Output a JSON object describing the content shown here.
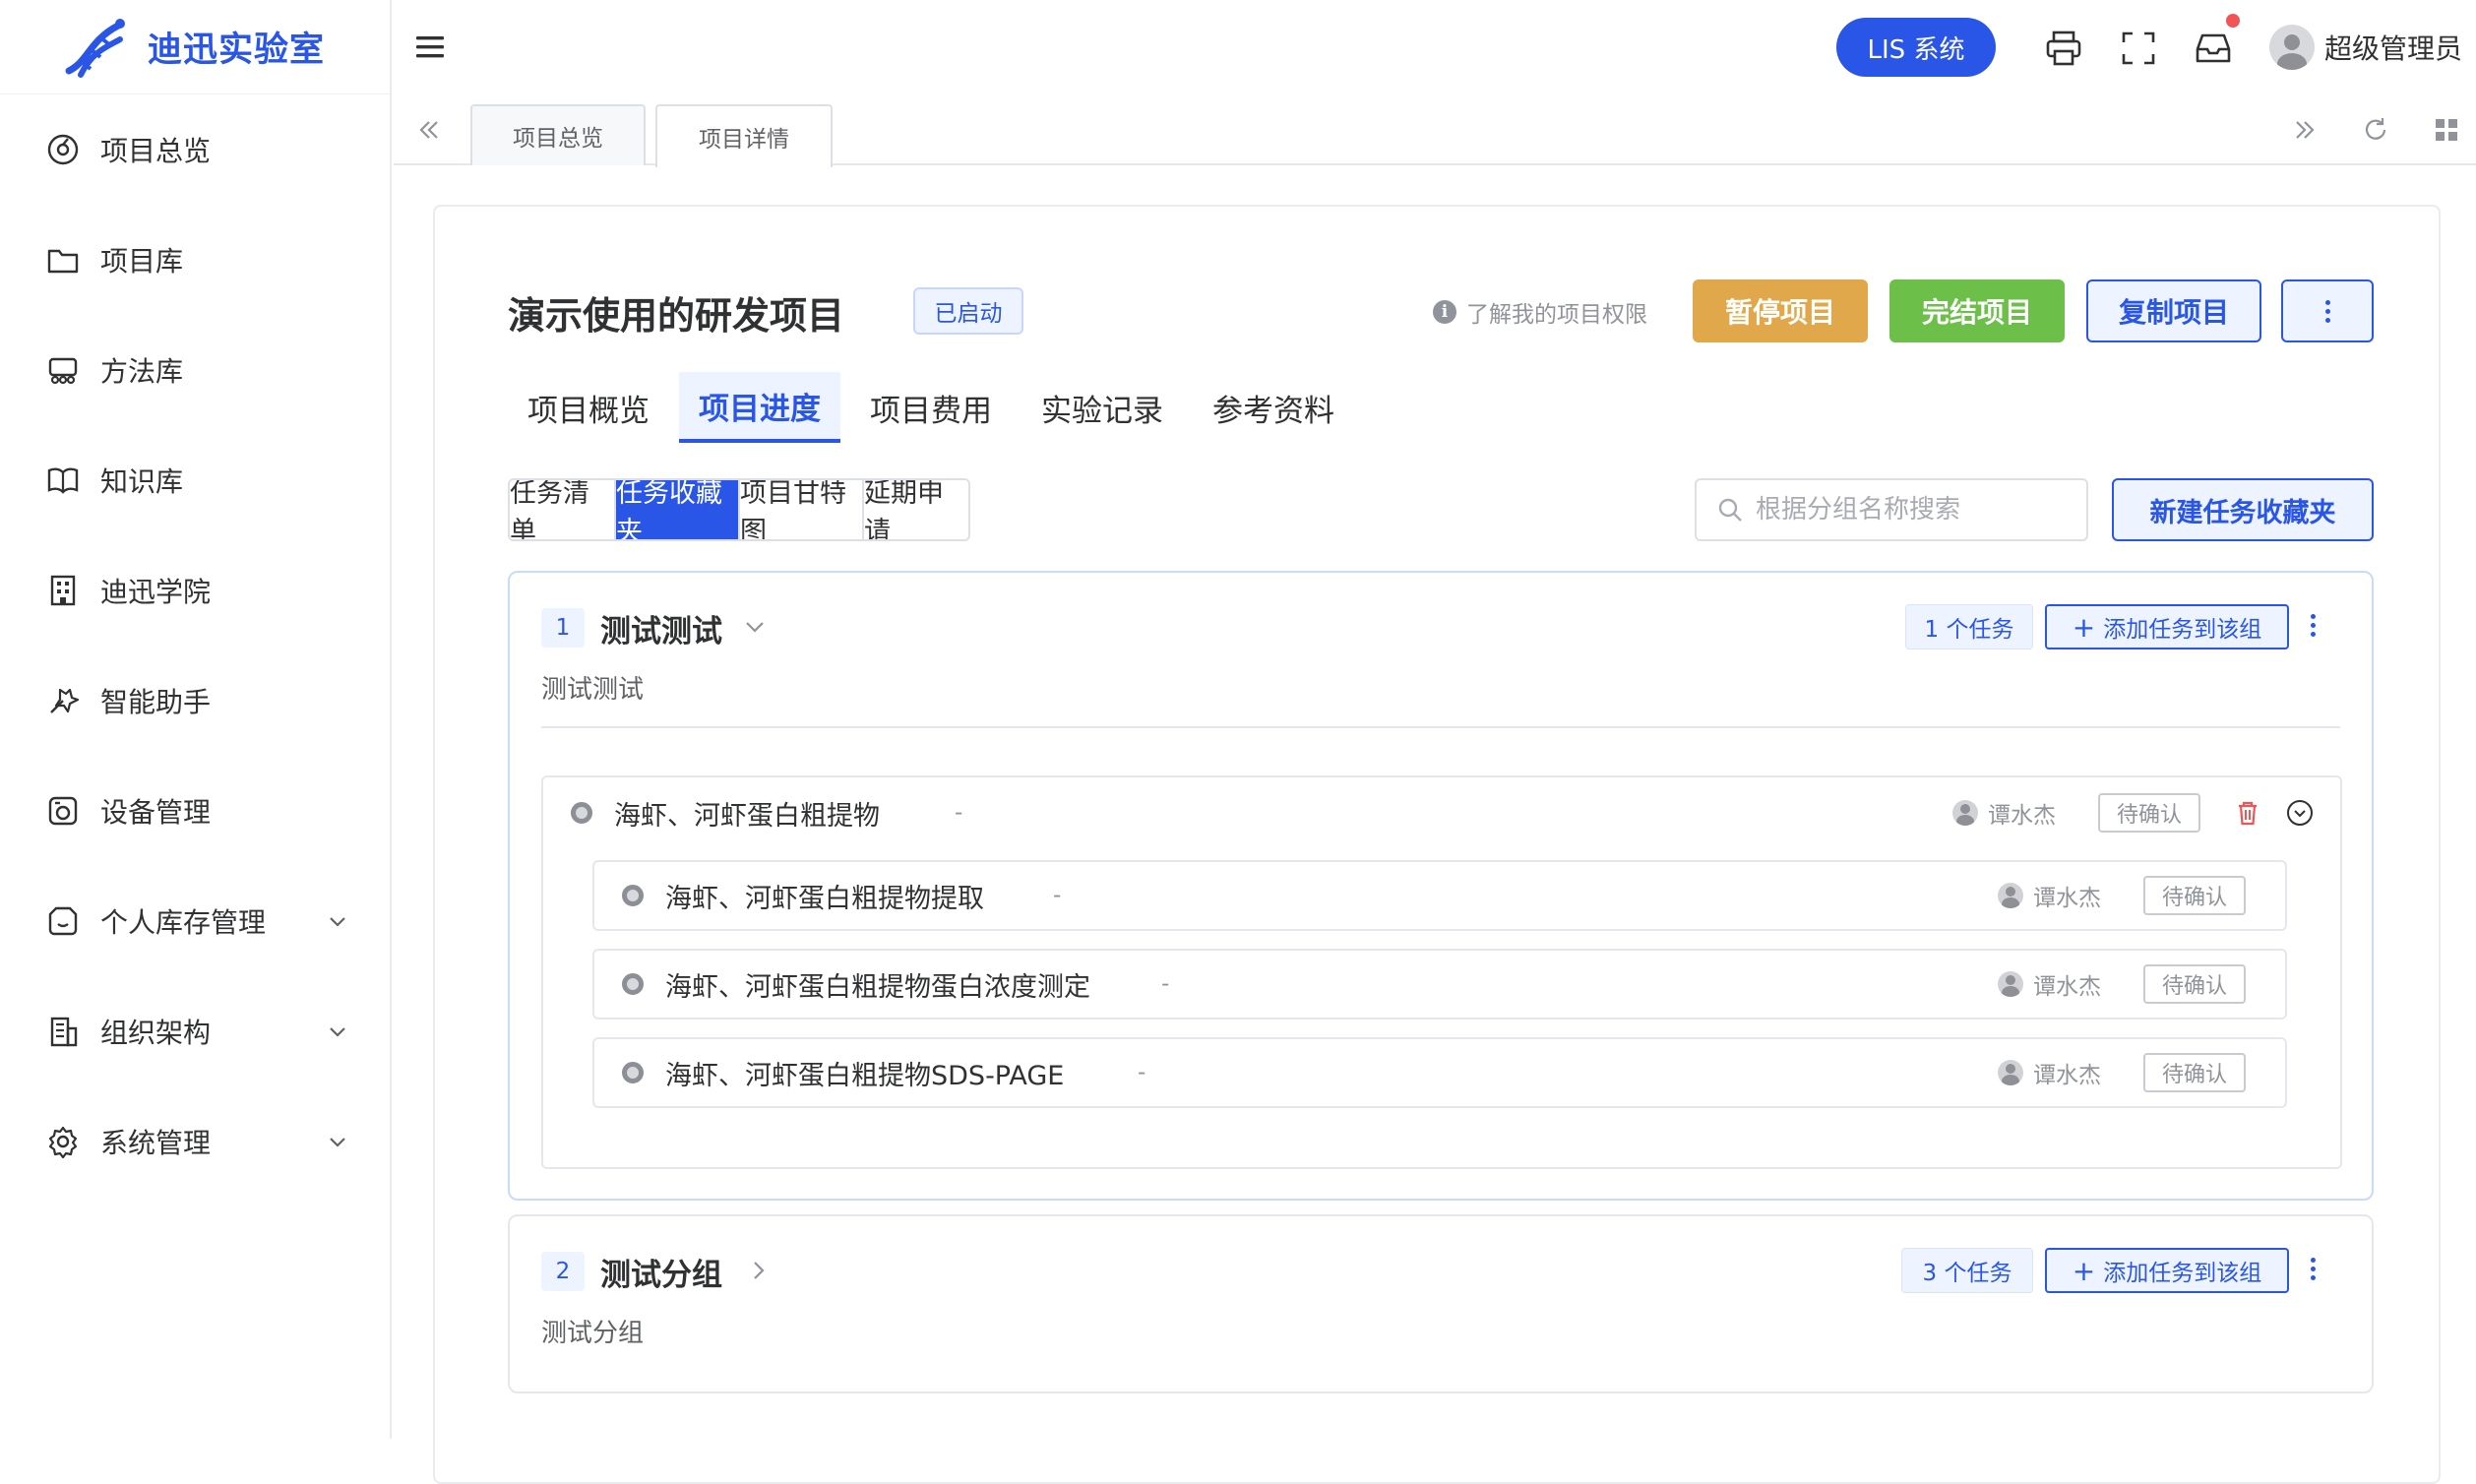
{
  "brand": {
    "name": "迪迅实验室",
    "color": "#2a56e8"
  },
  "sidebar": {
    "items": [
      {
        "label": "项目总览",
        "icon": "dashboard-icon"
      },
      {
        "label": "项目库",
        "icon": "folder-icon"
      },
      {
        "label": "方法库",
        "icon": "method-icon"
      },
      {
        "label": "知识库",
        "icon": "book-icon"
      },
      {
        "label": "迪迅学院",
        "icon": "building-icon"
      },
      {
        "label": "智能助手",
        "icon": "assistant-icon"
      },
      {
        "label": "设备管理",
        "icon": "device-icon"
      },
      {
        "label": "个人库存管理",
        "icon": "inventory-icon",
        "expandable": true
      },
      {
        "label": "组织架构",
        "icon": "org-icon",
        "expandable": true
      },
      {
        "label": "系统管理",
        "icon": "settings-icon",
        "expandable": true
      }
    ]
  },
  "topbar": {
    "lis_label": "LIS 系统",
    "user_name": "超级管理员",
    "notification_dot_color": "#f05454"
  },
  "page_tabs": [
    {
      "label": "项目总览",
      "active": false
    },
    {
      "label": "项目详情",
      "active": true
    }
  ],
  "project": {
    "title": "演示使用的研发项目",
    "status": "已启动",
    "permission_link": "了解我的项目权限",
    "info_glyph": "i",
    "actions": {
      "pause": "暂停项目",
      "finish": "完结项目",
      "copy": "复制项目"
    },
    "action_colors": {
      "pause": "#e0a84a",
      "finish": "#6cbf48",
      "copy": "#2a56e8"
    }
  },
  "main_tabs": [
    {
      "label": "项目概览",
      "active": false
    },
    {
      "label": "项目进度",
      "active": true
    },
    {
      "label": "项目费用",
      "active": false
    },
    {
      "label": "实验记录",
      "active": false
    },
    {
      "label": "参考资料",
      "active": false
    }
  ],
  "sub_tabs": [
    {
      "label": "任务清单",
      "active": false
    },
    {
      "label": "任务收藏夹",
      "active": true
    },
    {
      "label": "项目甘特图",
      "active": false
    },
    {
      "label": "延期申请",
      "active": false
    }
  ],
  "search": {
    "placeholder": "根据分组名称搜索",
    "value": ""
  },
  "new_folder_label": "新建任务收藏夹",
  "groups": [
    {
      "index": "1",
      "name": "测试测试",
      "description": "测试测试",
      "task_count": "1 个任务",
      "add_label": "添加任务到该组",
      "expanded": true,
      "tasks": [
        {
          "name": "海虾、河虾蛋白粗提物",
          "dash": "-",
          "assignee": "谭水杰",
          "state": "待确认",
          "children": [
            {
              "name": "海虾、河虾蛋白粗提物提取",
              "dash": "-",
              "assignee": "谭水杰",
              "state": "待确认"
            },
            {
              "name": "海虾、河虾蛋白粗提物蛋白浓度测定",
              "dash": "-",
              "assignee": "谭水杰",
              "state": "待确认"
            },
            {
              "name": "海虾、河虾蛋白粗提物SDS-PAGE",
              "dash": "-",
              "assignee": "谭水杰",
              "state": "待确认"
            }
          ]
        }
      ]
    },
    {
      "index": "2",
      "name": "测试分组",
      "description": "测试分组",
      "task_count": "3 个任务",
      "add_label": "添加任务到该组",
      "expanded": false
    }
  ]
}
